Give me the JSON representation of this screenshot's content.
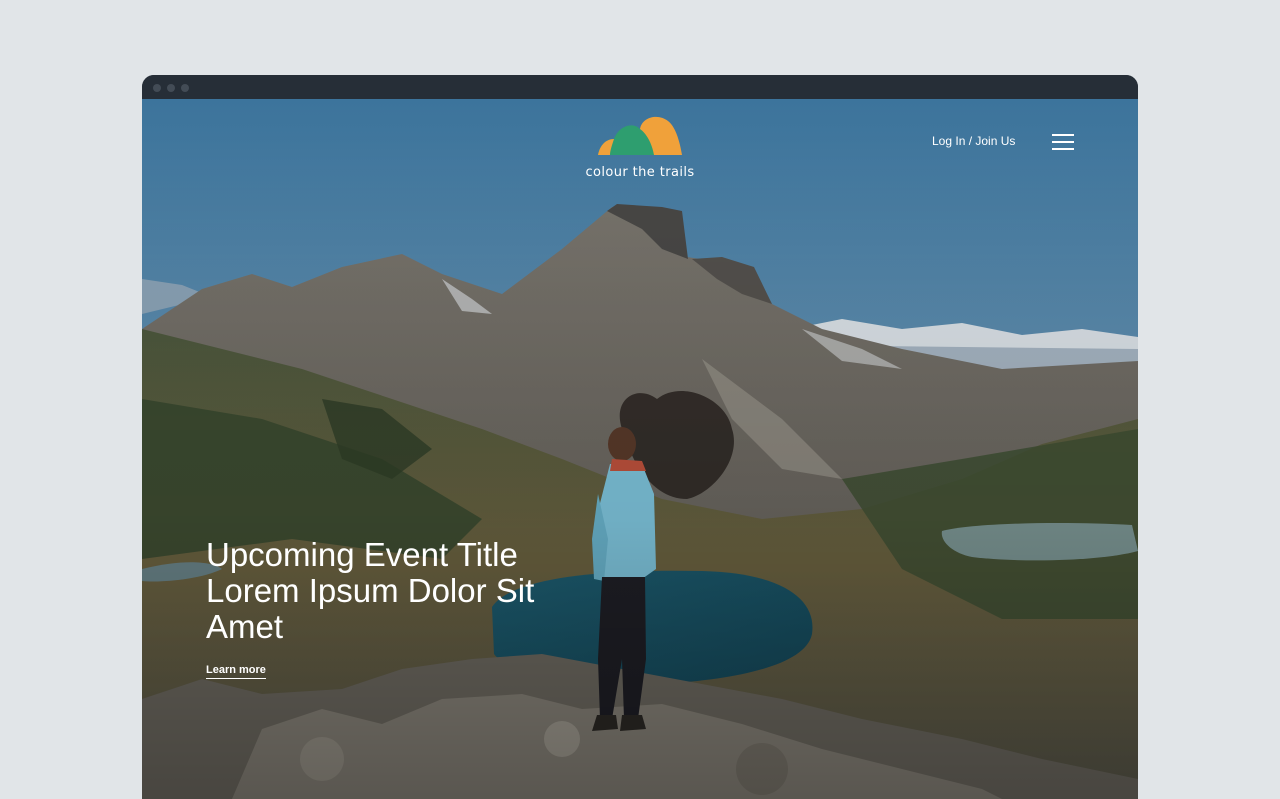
{
  "brand": {
    "name": "colour the trails",
    "colors": {
      "green": "#2e9e6f",
      "orange": "#f0a13a"
    }
  },
  "header": {
    "login_label": "Log In / Join Us",
    "menu_icon": "hamburger-menu-icon"
  },
  "hero": {
    "title": "Upcoming Event Title Lorem Ipsum Dolor Sit Amet",
    "cta_label": "Learn more",
    "image_description_icon": "mountain-hiker-photo"
  },
  "colors": {
    "page_bg": "#e1e5e8",
    "titlebar": "#262e37",
    "text": "#ffffff"
  }
}
